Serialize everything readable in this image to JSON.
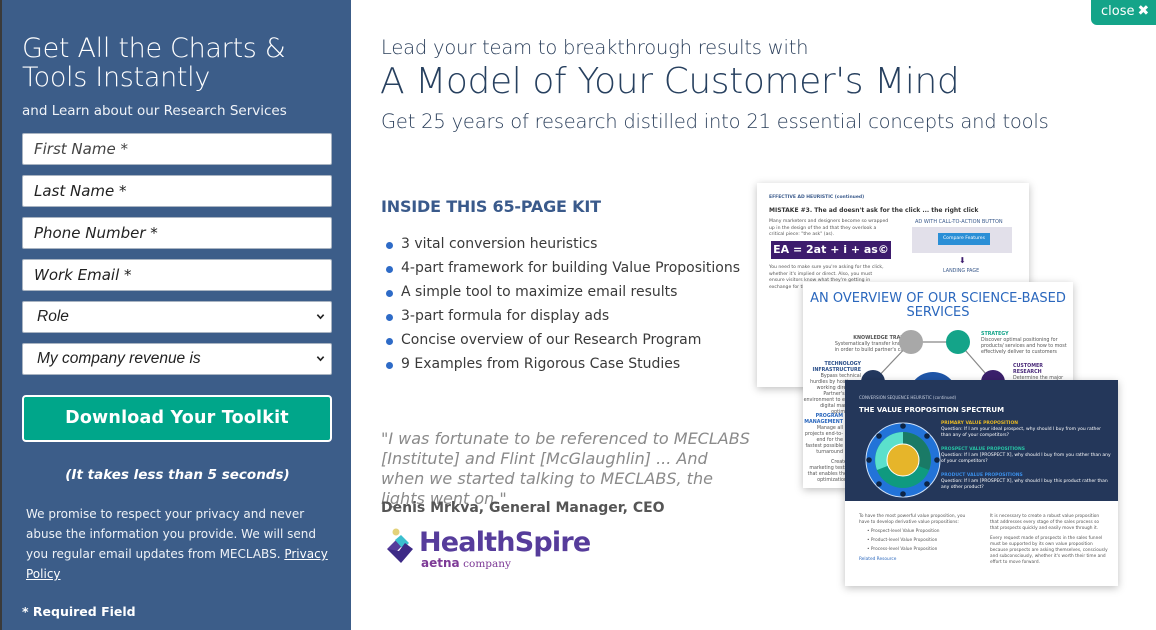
{
  "form": {
    "title": "Get All the Charts & Tools Instantly",
    "subtitle": "and Learn about our Research Services",
    "fields": {
      "first_name": {
        "placeholder": "First Name *",
        "value": ""
      },
      "last_name": {
        "placeholder": "Last Name *",
        "value": ""
      },
      "phone": {
        "placeholder": "Phone Number *",
        "value": ""
      },
      "email": {
        "placeholder": "Work Email *",
        "value": ""
      }
    },
    "role_select": {
      "selected": "Role"
    },
    "revenue_select": {
      "selected": "My company revenue is"
    },
    "submit_label": "Download Your Toolkit",
    "takes_less": "(It takes less than 5 seconds)",
    "privacy_text": "We promise to respect your privacy and never abuse the information you provide. We will send you regular email updates from MECLABS.",
    "privacy_link": "Privacy Policy",
    "required_note": "* Required Field"
  },
  "close": {
    "label": "close",
    "icon": "close-x-icon"
  },
  "hero": {
    "lead": "Lead your team to breakthrough results with",
    "headline": "A Model of Your Customer's Mind",
    "subhead": "Get 25 years of research distilled into 21 essential concepts and tools"
  },
  "kit": {
    "heading": "INSIDE THIS 65-PAGE KIT",
    "items": [
      "3 vital conversion heuristics",
      "4-part framework for building Value Propositions",
      "A simple tool to maximize email results",
      "3-part formula for display ads",
      "Concise overview of our Research Program",
      "9 Examples from Rigorous Case Studies"
    ]
  },
  "testimonial": {
    "quote": "\"I was fortunate to be referenced to MECLABS [Institute] and Flint [McGlaughlin] ... And when we started talking to MECLABS, the lights went on.\"",
    "author": "Denis Mrkva, General Manager, CEO",
    "logo_name": "HealthSpire",
    "logo_parent": "aetna",
    "logo_suffix": "company"
  },
  "preview": {
    "page1": {
      "tag": "EFFECTIVE AD HEURISTIC (continued)",
      "title": "MISTAKE #3. The ad doesn't ask for the click ... the right click",
      "text": "Many marketers and designers become so wrapped up in the design of the ad that they overlook a critical piece: \"the ask\" (as).",
      "equation": "EA = 2at + i + as©",
      "ad_label": "AD WITH CALL-TO-ACTION BUTTON",
      "ad_button": "Compare Features",
      "landing": "LANDING PAGE",
      "lower_text": "You need to make sure you're asking for the click, whether it's implied or direct. Also, you must ensure visitors know what they're getting in exchange for the click."
    },
    "page2": {
      "title": "AN OVERVIEW OF OUR SCIENCE-BASED SERVICES",
      "knowledge_title": "KNOWLEDGE TRANSFER",
      "knowledge_text": "Systematically transfer knowledge in order to build partner's capacity",
      "strategy_title": "STRATEGY",
      "strategy_text": "Discover optimal positioning for products/ services and how to most effectively deliver to customers",
      "tech_title": "TECHNOLOGY INFRASTRUCTURE",
      "tech_text": "Bypass technical hurdles by hosting or working directly in Partner's digital environment to execute digital marketing optimization",
      "customer_title": "CUSTOMER RESEARCH",
      "customer_text": "Determine the major",
      "program_title": "PROGRAM MANAGEMENT",
      "program_text": "Manage all projects end-to-end for the fastest possible turnaround",
      "bottom_text": "Create marketing tests that enables the optimization"
    },
    "page3": {
      "tag": "CONVERSION SEQUENCE HEURISTIC (continued)",
      "title": "THE VALUE PROPOSITION SPECTRUM",
      "vp": [
        {
          "title": "PRIMARY VALUE PROPOSITION",
          "question": "Question: If I am your ideal prospect, why should I buy from you rather than any of your competitors?",
          "color": "#e8b923"
        },
        {
          "title": "PROSPECT VALUE PROPOSITIONS",
          "question": "Question: If I am [PROSPECT X], why should I buy from you rather than any of your competitors?",
          "color": "#27c4a4"
        },
        {
          "title": "PRODUCT VALUE PROPOSITIONS",
          "question": "Question: If I am [PROSPECT X], why should I buy this product rather than any other product?",
          "color": "#3a8ee8"
        }
      ],
      "left_text": "To have the most powerful value proposition, you have to develop derivative value propositions:",
      "bullets": [
        "Prospect-level Value Proposition",
        "Product-level Value Proposition",
        "Process-level Value Proposition"
      ],
      "related": "Related Resource",
      "right_text_1": "It is necessary to create a robust value proposition that addresses every stage of the sales process so that prospects quickly and easily move through it.",
      "right_text_2": "Every request made of prospects in the sales funnel must be supported by its own value proposition because prospects are asking themselves, consciously and subconsciously, whether it's worth their time and effort to move forward."
    }
  },
  "colors": {
    "panel_bg": "#3c5d89",
    "accent_green": "#00a68a",
    "headline_blue": "#27405f",
    "bullet_blue": "#2e6bc7",
    "brand_purple": "#563c9b"
  }
}
